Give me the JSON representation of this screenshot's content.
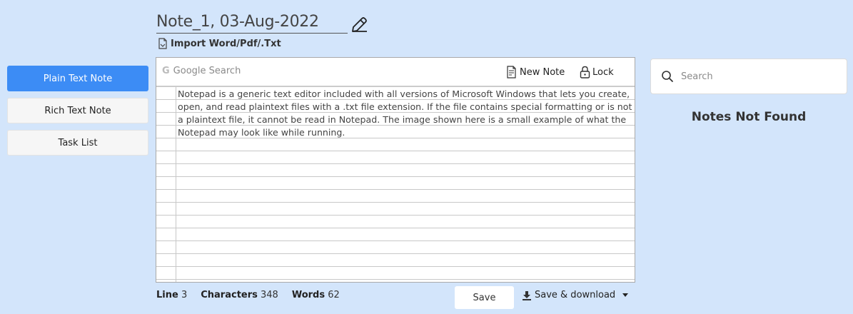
{
  "note": {
    "title": "Note_1, 03-Aug-2022",
    "import_label": "Import Word/Pdf/.Txt",
    "lines": [
      "Notepad is a generic text editor included with all versions of Microsoft Windows that lets you create,",
      "open, and read plaintext files with a .txt file extension. If the file contains special formatting or is not",
      "a plaintext file, it cannot be read in Notepad. The image shown here is a small example of what the",
      "Notepad may look like while running."
    ]
  },
  "sidebar": {
    "items": [
      {
        "label": "Plain Text Note",
        "active": true
      },
      {
        "label": "Rich Text Note",
        "active": false
      },
      {
        "label": "Task List",
        "active": false
      }
    ]
  },
  "toolbar": {
    "google_placeholder": "Google Search",
    "google_icon": "G",
    "new_note_label": "New Note",
    "lock_label": "Lock"
  },
  "status": {
    "line_label": "Line",
    "line_value": "3",
    "chars_label": "Characters",
    "chars_value": "348",
    "words_label": "Words",
    "words_value": "62"
  },
  "actions": {
    "save_label": "Save",
    "save_download_label": "Save & download"
  },
  "notes_panel": {
    "search_placeholder": "Search",
    "empty_message": "Notes Not Found"
  },
  "colors": {
    "background": "#d3e5fb",
    "accent": "#3c8cf5"
  }
}
